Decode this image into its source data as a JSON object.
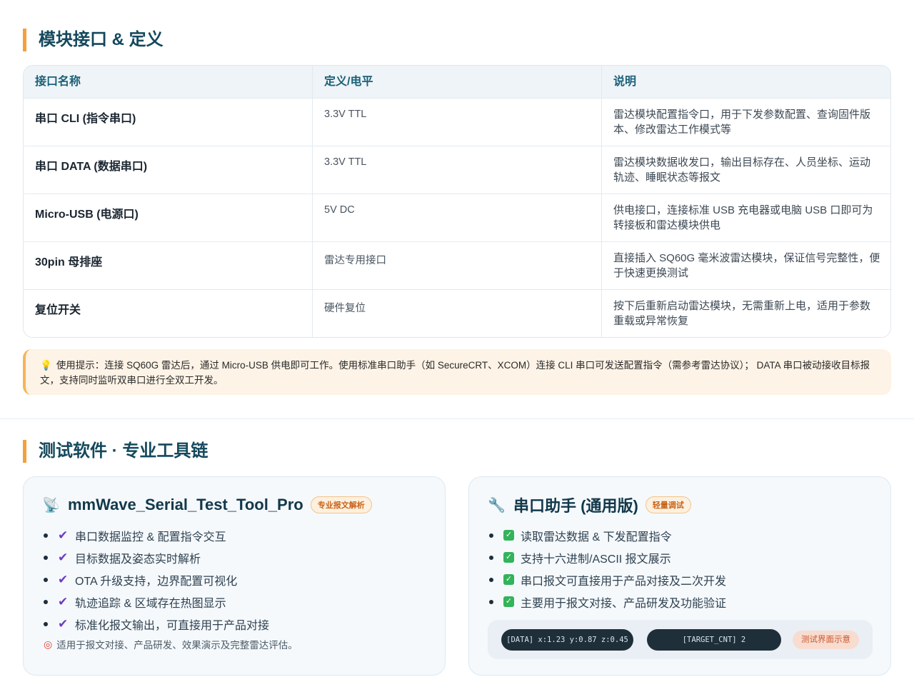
{
  "section1": {
    "title": "模块接口 & 定义"
  },
  "table": {
    "headers": [
      "接口名称",
      "定义/电平",
      "说明"
    ],
    "rows": [
      {
        "name": "串口 CLI (指令串口)",
        "def": "3.3V TTL",
        "desc": "雷达模块配置指令口，用于下发参数配置、查询固件版本、修改雷达工作模式等"
      },
      {
        "name": "串口 DATA (数据串口)",
        "def": "3.3V TTL",
        "desc": "雷达模块数据收发口，输出目标存在、人员坐标、运动轨迹、睡眠状态等报文"
      },
      {
        "name": "Micro-USB (电源口)",
        "def": "5V DC",
        "desc": "供电接口，连接标准 USB 充电器或电脑 USB 口即可为转接板和雷达模块供电"
      },
      {
        "name": "30pin 母排座",
        "def": "雷达专用接口",
        "desc": "直接插入 SQ60G 毫米波雷达模块，保证信号完整性，便于快速更换测试"
      },
      {
        "name": "复位开关",
        "def": "硬件复位",
        "desc": "按下后重新启动雷达模块，无需重新上电，适用于参数重载或异常恢复"
      }
    ]
  },
  "tip": {
    "icon": "lightbulb-icon",
    "text": "使用提示：连接 SQ60G 雷达后，通过 Micro-USB 供电即可工作。使用标准串口助手（如 SecureCRT、XCOM）连接 CLI 串口可发送配置指令（需参考雷达协议）； DATA 串口被动接收目标报文，支持同时监听双串口进行全双工开发。"
  },
  "section2": {
    "title": "测试软件 · 专业工具链"
  },
  "card_left": {
    "icon": "satellite-dish-icon",
    "title": "mmWave_Serial_Test_Tool_Pro",
    "badge": "专业报文解析",
    "features": [
      "串口数据监控 & 配置指令交互",
      "目标数据及姿态实时解析",
      "OTA 升级支持，边界配置可视化",
      "轨迹追踪 & 区域存在热图显示",
      "标准化报文输出，可直接用于产品对接"
    ],
    "footnote_icon": "target-icon",
    "footnote": "适用于报文对接、产品研发、效果演示及完整雷达评估。"
  },
  "card_right": {
    "icon": "wrench-icon",
    "title": "串口助手 (通用版)",
    "badge": "轻量调试",
    "features": [
      "读取雷达数据 & 下发配置指令",
      "支持十六进制/ASCII 报文展示",
      "串口报文可直接用于产品对接及二次开发",
      "主要用于报文对接、产品研发及功能验证"
    ],
    "demo": {
      "line1": "[DATA] x:1.23 y:0.87 z:0.45",
      "line2": "[TARGET_CNT] 2",
      "label": "测试界面示意"
    }
  },
  "colors": {
    "accent": "#f5a03b",
    "heading": "#14485c",
    "check_purple": "#6c3bc6",
    "check_green": "#33b35a"
  }
}
